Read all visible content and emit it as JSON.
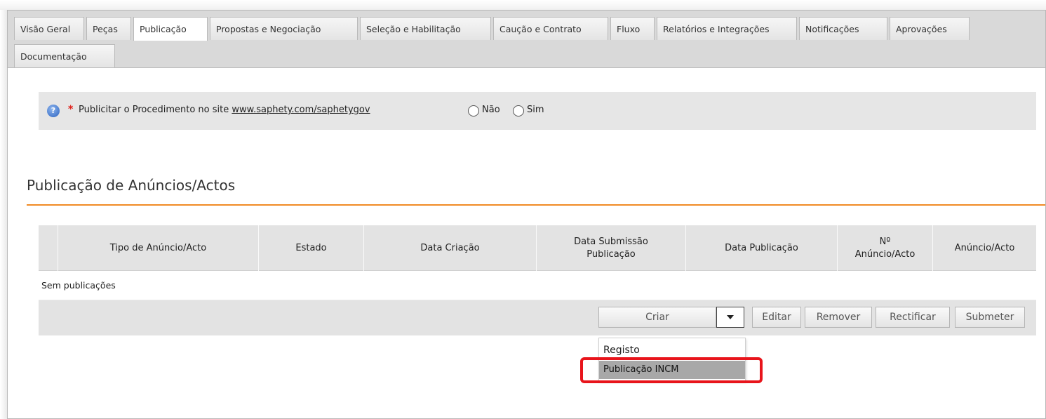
{
  "tabs": [
    {
      "label": "Visão Geral",
      "active": false
    },
    {
      "label": "Peças",
      "active": false
    },
    {
      "label": "Publicação",
      "active": true
    },
    {
      "label": "Propostas e Negociação",
      "active": false
    },
    {
      "label": "Seleção e Habilitação",
      "active": false
    },
    {
      "label": "Caução e Contrato",
      "active": false
    },
    {
      "label": "Fluxo",
      "active": false
    },
    {
      "label": "Relatórios e Integrações",
      "active": false
    },
    {
      "label": "Notificações",
      "active": false
    },
    {
      "label": "Aprovações",
      "active": false
    },
    {
      "label": "Documentação",
      "active": false
    }
  ],
  "publicitar": {
    "required_mark": "*",
    "label": "Publicitar o Procedimento no site",
    "link": "www.saphety.com/saphetygov",
    "options": [
      "Não",
      "Sim"
    ],
    "help_icon": "question-circle-icon"
  },
  "section": {
    "title": "Publicação de Anúncios/Actos"
  },
  "table": {
    "columns": [
      "Tipo de Anúncio/Acto",
      "Estado",
      "Data Criação",
      "Data Submissão Publicação",
      "Data Publicação",
      "Nº Anúncio/Acto",
      "Anúncio/Acto"
    ],
    "empty_message": "Sem publicações"
  },
  "toolbar": {
    "criar": "Criar",
    "editar": "Editar",
    "remover": "Remover",
    "rectificar": "Rectificar",
    "submeter": "Submeter"
  },
  "dropdown": {
    "items": [
      "Registo",
      "Publicação INCM"
    ],
    "highlighted_index": 1
  },
  "colors": {
    "accent_rule": "#f08a24",
    "highlight_box": "#e8141b",
    "required": "#e0201a"
  }
}
